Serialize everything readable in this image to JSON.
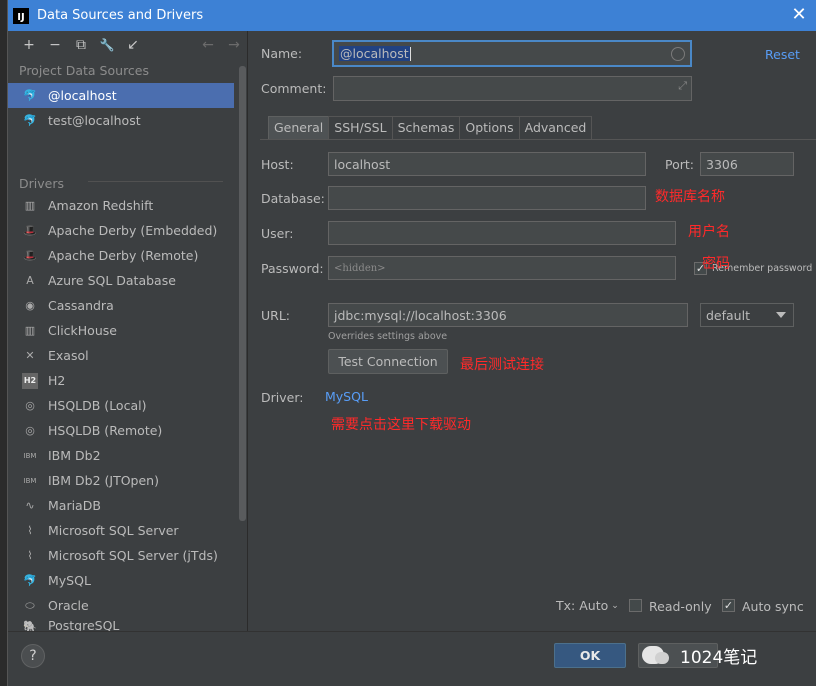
{
  "title_bar": {
    "title": "Data Sources and Drivers",
    "close_glyph": "✕",
    "logo_text": "IJ"
  },
  "toolbar": {
    "buttons": [
      {
        "name": "add-icon",
        "glyph": "+"
      },
      {
        "name": "remove-icon",
        "glyph": "−"
      },
      {
        "name": "duplicate-icon",
        "glyph": "⧉"
      },
      {
        "name": "wrench-icon",
        "glyph": "🔧"
      },
      {
        "name": "import-icon",
        "glyph": "↙"
      }
    ],
    "nav": [
      {
        "name": "back-arrow-icon",
        "glyph": "←"
      },
      {
        "name": "forward-arrow-icon",
        "glyph": "→"
      }
    ]
  },
  "project_data_sources": {
    "title": "Project Data Sources",
    "items": [
      {
        "label": "@localhost",
        "icon": "mysql-dolphin-icon",
        "glyph": "🐬",
        "selected": true
      },
      {
        "label": "test@localhost",
        "icon": "mysql-dolphin-icon",
        "glyph": "🐬",
        "selected": false
      }
    ]
  },
  "drivers": {
    "title": "Drivers",
    "items": [
      {
        "label": "Amazon Redshift",
        "icon": "redshift-icon",
        "glyph": "▥"
      },
      {
        "label": "Apache Derby (Embedded)",
        "icon": "derby-hat-icon",
        "glyph": "🎩"
      },
      {
        "label": "Apache Derby (Remote)",
        "icon": "derby-hat-icon",
        "glyph": "🎩"
      },
      {
        "label": "Azure SQL Database",
        "icon": "azure-icon",
        "glyph": "A"
      },
      {
        "label": "Cassandra",
        "icon": "cassandra-icon",
        "glyph": "◉"
      },
      {
        "label": "ClickHouse",
        "icon": "clickhouse-icon",
        "glyph": "▥"
      },
      {
        "label": "Exasol",
        "icon": "exasol-icon",
        "glyph": "✕"
      },
      {
        "label": "H2",
        "icon": "h2-icon",
        "glyph": "H2"
      },
      {
        "label": "HSQLDB (Local)",
        "icon": "hsqldb-icon",
        "glyph": "◎"
      },
      {
        "label": "HSQLDB (Remote)",
        "icon": "hsqldb-icon",
        "glyph": "◎"
      },
      {
        "label": "IBM Db2",
        "icon": "ibm-db2-icon",
        "glyph": "IBM"
      },
      {
        "label": "IBM Db2 (JTOpen)",
        "icon": "ibm-db2-icon",
        "glyph": "IBM"
      },
      {
        "label": "MariaDB",
        "icon": "mariadb-seal-icon",
        "glyph": "∿"
      },
      {
        "label": "Microsoft SQL Server",
        "icon": "sqlserver-icon",
        "glyph": "⌇"
      },
      {
        "label": "Microsoft SQL Server (jTds)",
        "icon": "sqlserver-icon",
        "glyph": "⌇"
      },
      {
        "label": "MySQL",
        "icon": "mysql-dolphin-icon",
        "glyph": "🐬"
      },
      {
        "label": "Oracle",
        "icon": "oracle-icon",
        "glyph": "⬭"
      },
      {
        "label": "PostgreSQL",
        "icon": "postgresql-icon",
        "glyph": "🐘"
      }
    ]
  },
  "form": {
    "name_label": "Name:",
    "name_value": "@localhost",
    "comment_label": "Comment:",
    "comment_value": "",
    "reset_label": "Reset",
    "tabs": [
      "General",
      "SSH/SSL",
      "Schemas",
      "Options",
      "Advanced"
    ],
    "host_label": "Host:",
    "host_value": "localhost",
    "port_label": "Port:",
    "port_value": "3306",
    "database_label": "Database:",
    "database_value": "",
    "user_label": "User:",
    "user_value": "",
    "password_label": "Password:",
    "password_placeholder": "<hidden>",
    "remember_password_label": "Remember password",
    "remember_password_checked": true,
    "url_label": "URL:",
    "url_value": "jdbc:mysql://localhost:3306",
    "url_hint": "Overrides settings above",
    "url_mode": "default",
    "test_connection_label": "Test Connection",
    "driver_label": "Driver:",
    "driver_value": "MySQL"
  },
  "annotations": {
    "database": "数据库名称",
    "user": "用户名",
    "password": "密码",
    "test": "最后测试连接",
    "driver": "需要点击这里下载驱动"
  },
  "footer_controls": {
    "tx_label": "Tx: Auto",
    "readonly_label": "Read-only",
    "readonly_checked": false,
    "autosync_label": "Auto sync",
    "autosync_checked": true
  },
  "bottom": {
    "help_glyph": "?",
    "ok_label": "OK",
    "watermark_text": "1024笔记"
  }
}
